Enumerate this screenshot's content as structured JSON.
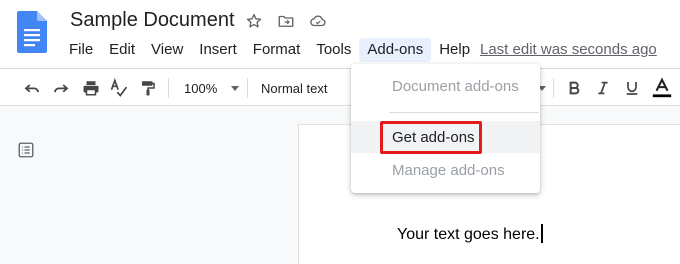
{
  "document": {
    "title": "Sample Document",
    "body_text": "Your text goes here."
  },
  "menubar": {
    "items": [
      {
        "label": "File"
      },
      {
        "label": "Edit"
      },
      {
        "label": "View"
      },
      {
        "label": "Insert"
      },
      {
        "label": "Format"
      },
      {
        "label": "Tools"
      },
      {
        "label": "Add-ons"
      },
      {
        "label": "Help"
      }
    ],
    "active": "Add-ons",
    "last_edit": "Last edit was seconds ago"
  },
  "toolbar": {
    "zoom": "100%",
    "style": "Normal text",
    "icons": [
      "undo-icon",
      "redo-icon",
      "print-icon",
      "spellcheck-icon",
      "paint-format-icon",
      "bold-icon",
      "italic-icon",
      "underline-icon",
      "text-color-icon"
    ]
  },
  "addons_menu": {
    "items": [
      {
        "label": "Document add-ons",
        "enabled": false
      },
      {
        "label": "Get add-ons",
        "enabled": true,
        "highlighted": true
      },
      {
        "label": "Manage add-ons",
        "enabled": false
      }
    ]
  },
  "colors": {
    "accent_highlight": "#e21b1b",
    "active_menu_bg": "#e8f0fe",
    "docs_blue": "#4285f4"
  }
}
